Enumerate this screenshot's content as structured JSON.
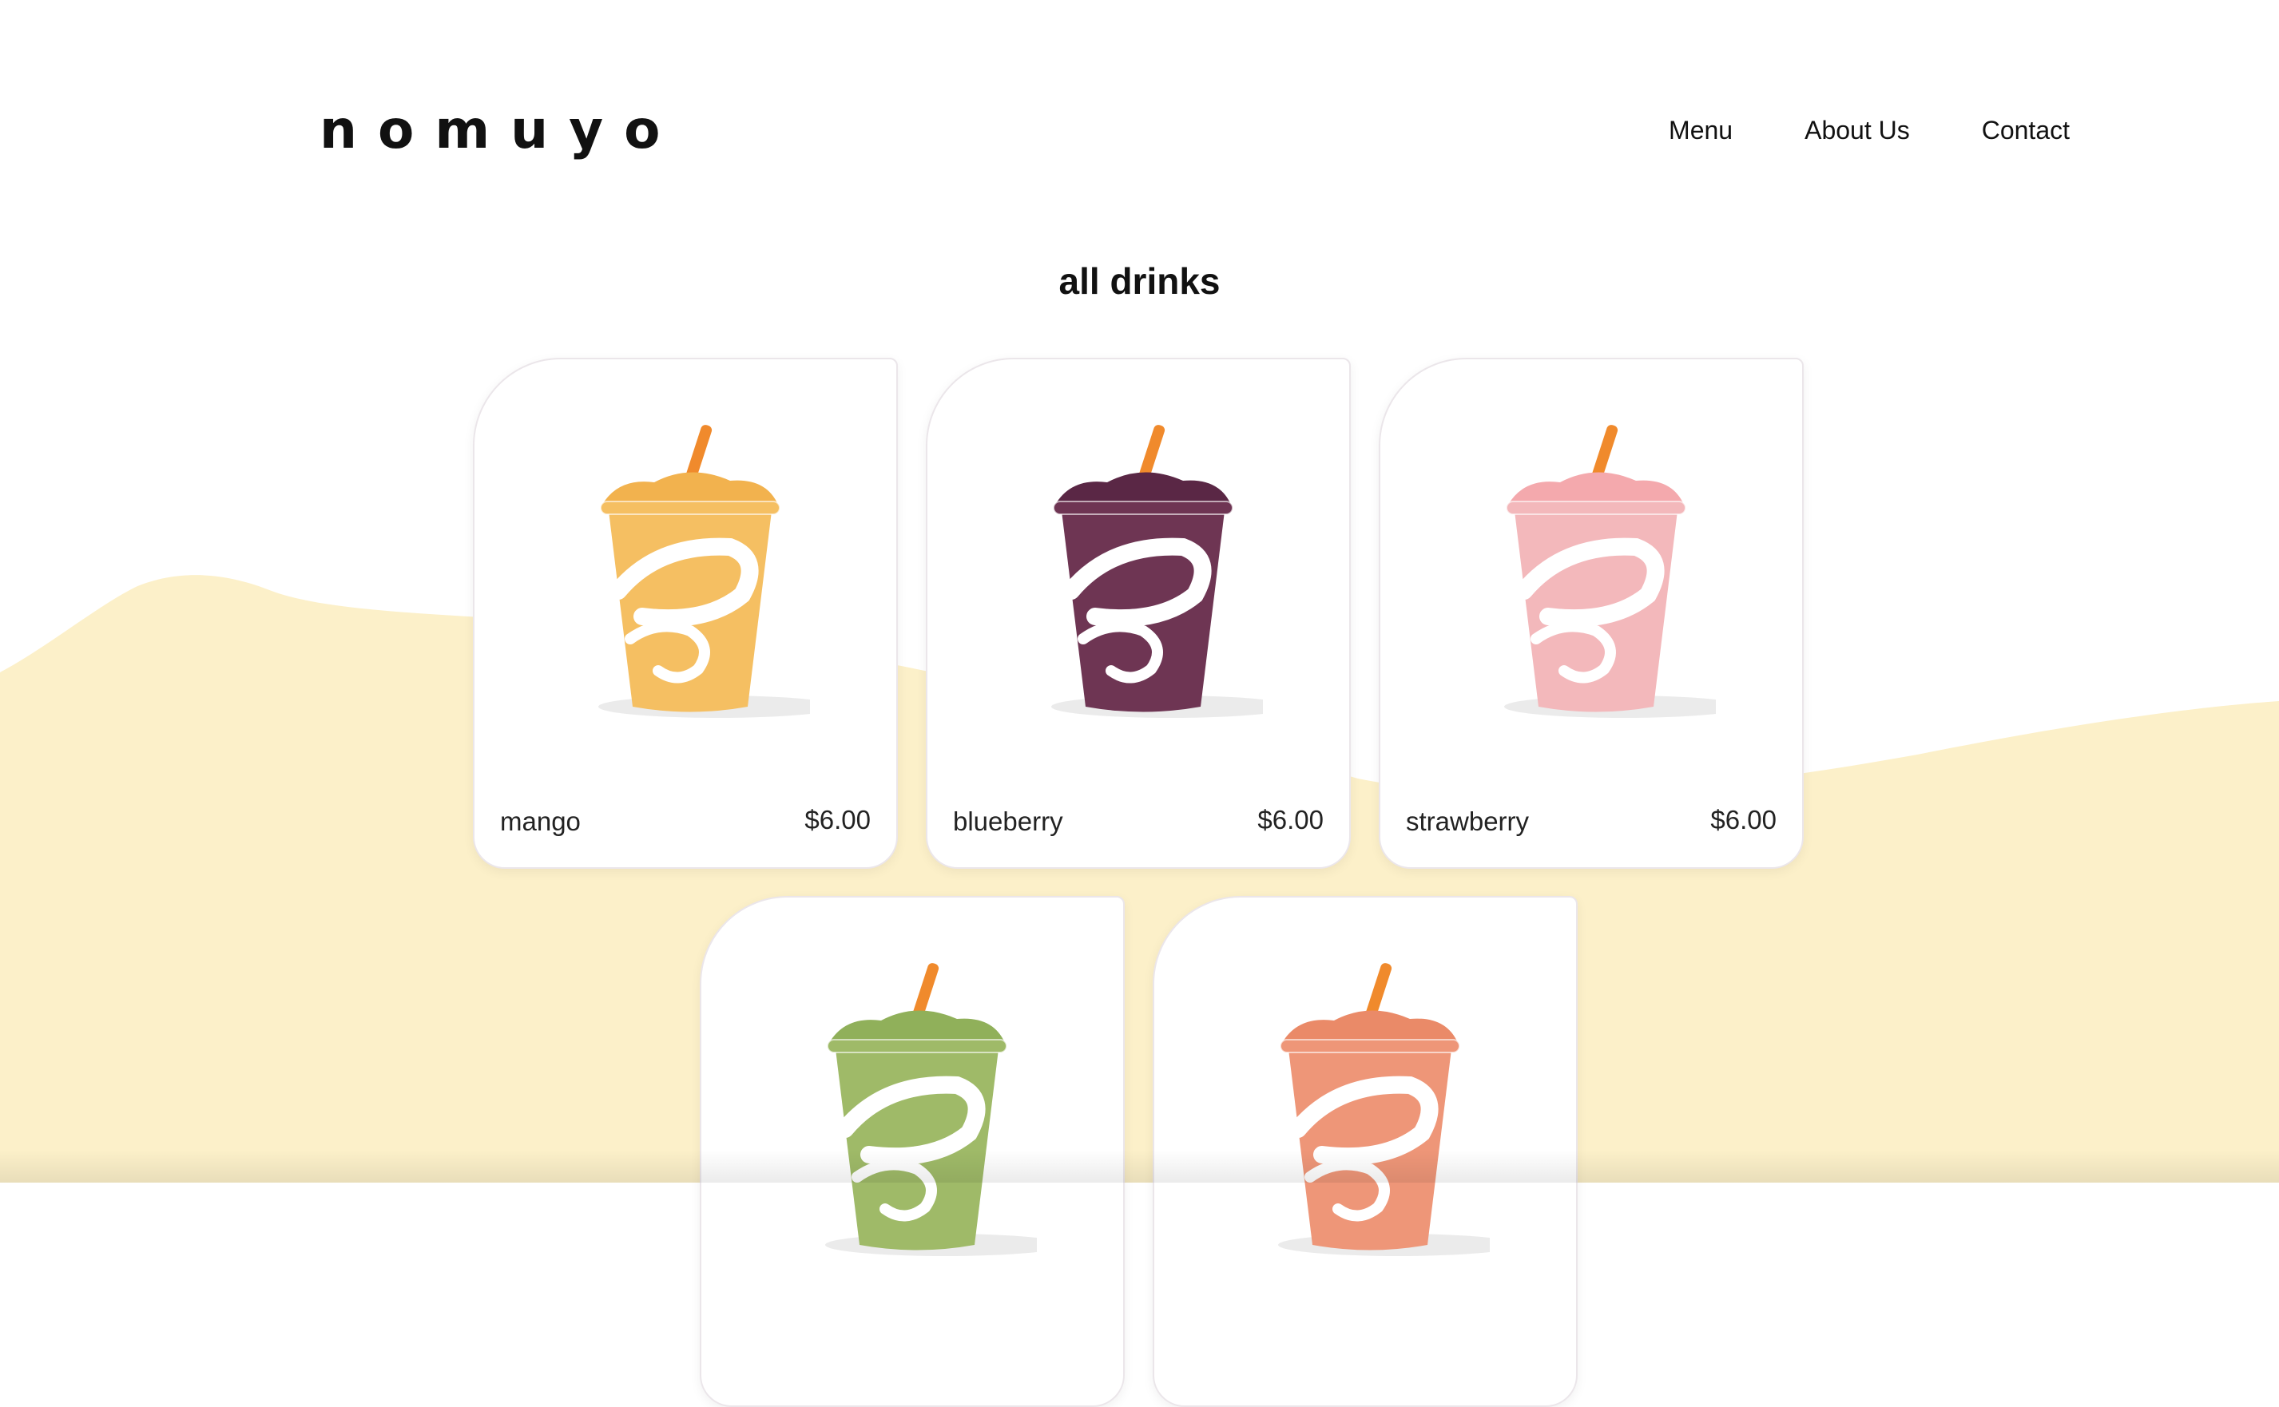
{
  "brand": {
    "logo": "nomuyo"
  },
  "nav": {
    "items": [
      {
        "label": "Menu"
      },
      {
        "label": "About Us"
      },
      {
        "label": "Contact"
      }
    ]
  },
  "section": {
    "title": "all drinks"
  },
  "colors": {
    "wave": "#fcf0c9",
    "card_border": "#ebe6ea",
    "straw": "#f08a2c"
  },
  "drinks": [
    {
      "name": "mango",
      "price": "$6.00",
      "color": "#f5bf62",
      "top_color": "#f2b24e"
    },
    {
      "name": "blueberry",
      "price": "$6.00",
      "color": "#6e3553",
      "top_color": "#5a2745"
    },
    {
      "name": "strawberry",
      "price": "$6.00",
      "color": "#f3b8bb",
      "top_color": "#f4a9ad"
    },
    {
      "name": "",
      "price": "",
      "color": "#9fba68",
      "top_color": "#90b05a"
    },
    {
      "name": "",
      "price": "",
      "color": "#ee9678",
      "top_color": "#ea8a68"
    }
  ]
}
